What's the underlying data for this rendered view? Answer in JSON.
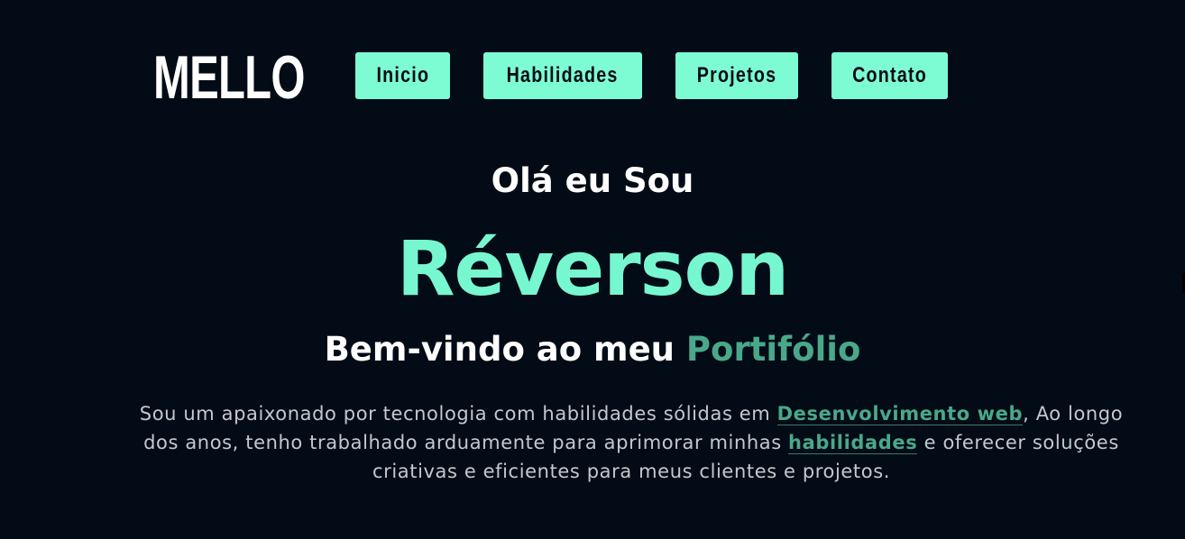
{
  "brand": {
    "logo_text": "MELLO"
  },
  "nav": {
    "items": [
      {
        "label": "Inicio"
      },
      {
        "label": "Habilidades"
      },
      {
        "label": "Projetos"
      },
      {
        "label": "Contato"
      }
    ]
  },
  "hero": {
    "greeting": "Olá eu Sou",
    "name": "Réverson",
    "welcome_prefix": "Bem-vindo ao meu",
    "welcome_accent": "Portifólio",
    "text_part1": "Sou um apaixonado por tecnologia com habilidades sólidas em ",
    "link1": "Desenvolvimento web",
    "text_part2": ", Ao longo dos anos, tenho trabalhado arduamente para aprimorar minhas ",
    "link2": "habilidades",
    "text_part3": " e oferecer soluções criativas e eficientes para meus clientes e projetos."
  },
  "colors": {
    "background": "#030b16",
    "accent": "#7dfcd3",
    "accent_dark": "#4aa88a",
    "text": "#ffffff",
    "muted_text": "#c4c8ce"
  }
}
